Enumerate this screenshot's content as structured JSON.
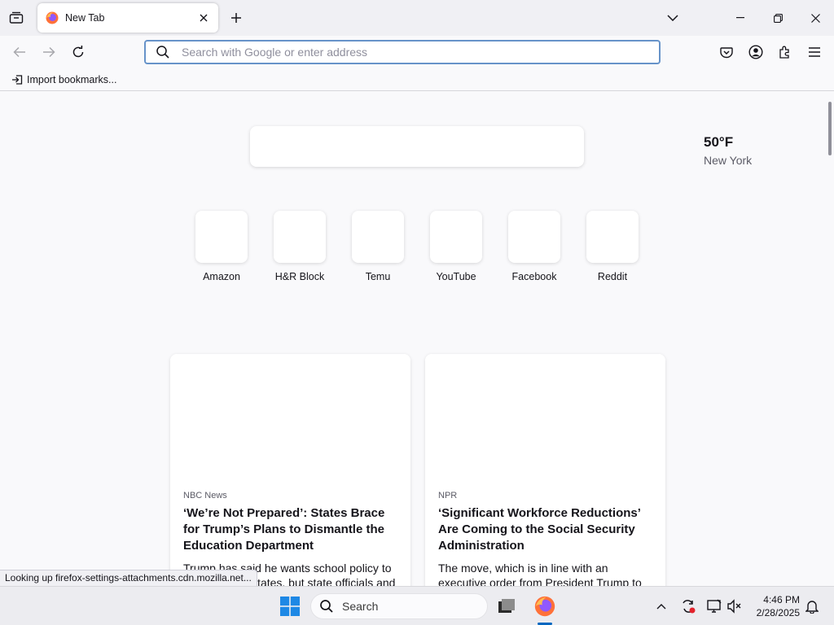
{
  "browser": {
    "tab": {
      "title": "New Tab"
    },
    "url_placeholder": "Search with Google or enter address",
    "bookmarks": {
      "import_label": "Import bookmarks..."
    }
  },
  "newtab": {
    "weather": {
      "temp": "50°F",
      "city": "New York"
    },
    "top_sites": [
      {
        "label": "Amazon"
      },
      {
        "label": "H&R Block"
      },
      {
        "label": "Temu"
      },
      {
        "label": "YouTube"
      },
      {
        "label": "Facebook"
      },
      {
        "label": "Reddit"
      }
    ],
    "stories": [
      {
        "source": "NBC News",
        "title": "‘We’re Not Prepared’: States Brace for Trump’s Plans to Dismantle the Education Department",
        "excerpt": "Trump has said he wants school policy to be set by the states, but state officials and"
      },
      {
        "source": "NPR",
        "title": "‘Significant Workforce Reductions’ Are Coming to the Social Security Administration",
        "excerpt": "The move, which is in line with an executive order from President Trump to"
      }
    ]
  },
  "status_text": "Looking up firefox-settings-attachments.cdn.mozilla.net...",
  "taskbar": {
    "search_label": "Search",
    "clock_time": "4:46 PM",
    "clock_date": "2/28/2025"
  },
  "colors": {
    "accent": "#0067c0",
    "urlbar_border": "#6793c9",
    "firefox_orange": "#ff7139",
    "firefox_purple": "#9059ff"
  },
  "icons": {
    "tab_favicon": "firefox-icon",
    "tabs_list": "tab-manager-icon",
    "new_tab": "plus-icon",
    "pocket": "pocket-icon",
    "account": "account-icon",
    "extensions": "extensions-icon",
    "menu": "hamburger-menu-icon"
  }
}
